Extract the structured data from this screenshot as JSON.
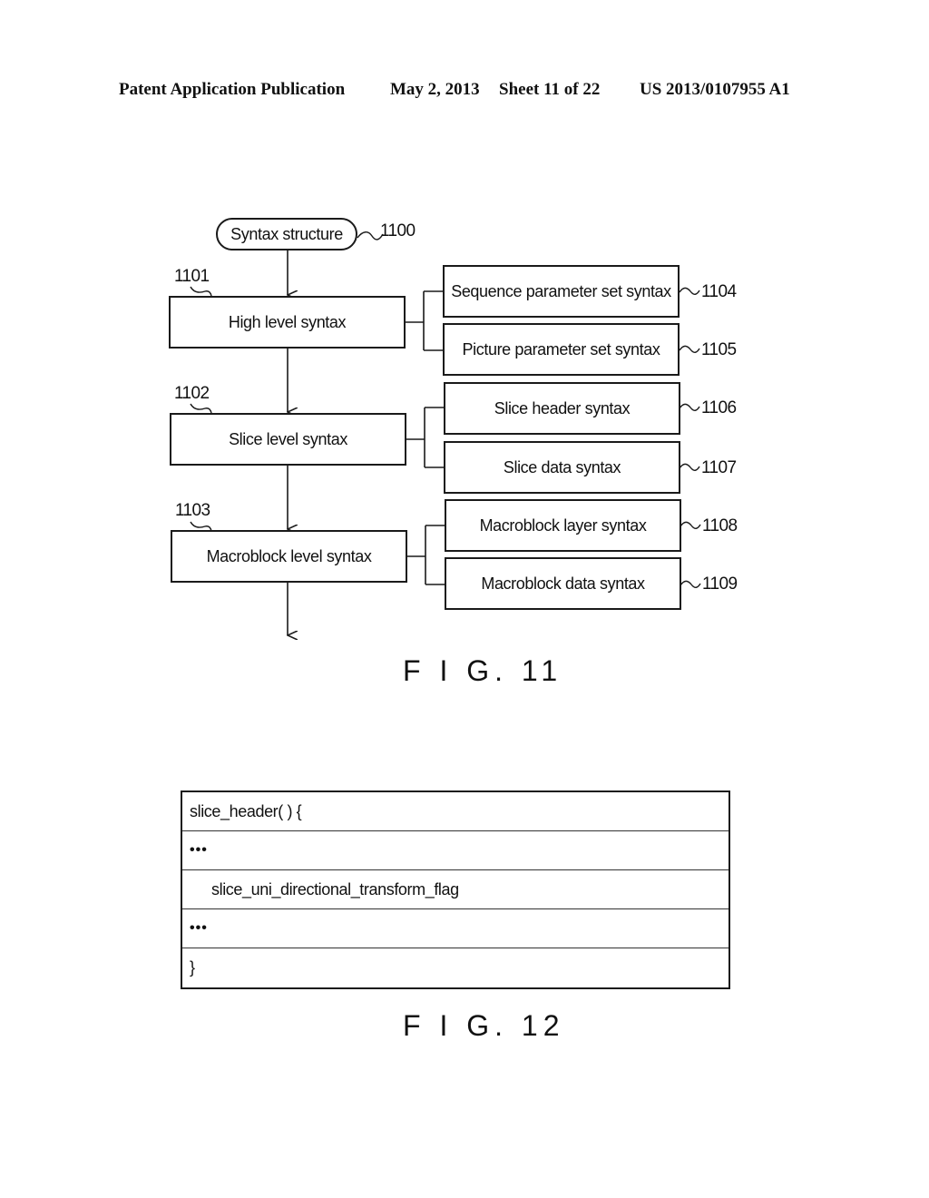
{
  "header": {
    "publication": "Patent Application Publication",
    "date": "May 2, 2013",
    "sheet": "Sheet 11 of 22",
    "number": "US 2013/0107955 A1"
  },
  "fig11": {
    "caption": "F I G. 11",
    "root": {
      "label": "Syntax structure",
      "ref": "1100"
    },
    "levels": [
      {
        "label": "High level syntax",
        "ref": "1101",
        "children": [
          {
            "label": "Sequence parameter set syntax",
            "ref": "1104"
          },
          {
            "label": "Picture parameter set syntax",
            "ref": "1105"
          }
        ]
      },
      {
        "label": "Slice level syntax",
        "ref": "1102",
        "children": [
          {
            "label": "Slice header syntax",
            "ref": "1106"
          },
          {
            "label": "Slice data syntax",
            "ref": "1107"
          }
        ]
      },
      {
        "label": "Macroblock level syntax",
        "ref": "1103",
        "children": [
          {
            "label": "Macroblock layer syntax",
            "ref": "1108"
          },
          {
            "label": "Macroblock data syntax",
            "ref": "1109"
          }
        ]
      }
    ]
  },
  "fig12": {
    "caption": "F I G. 12",
    "rows": [
      "slice_header( ) {",
      "•••",
      "slice_uni_directional_transform_flag",
      "•••",
      "}"
    ]
  }
}
